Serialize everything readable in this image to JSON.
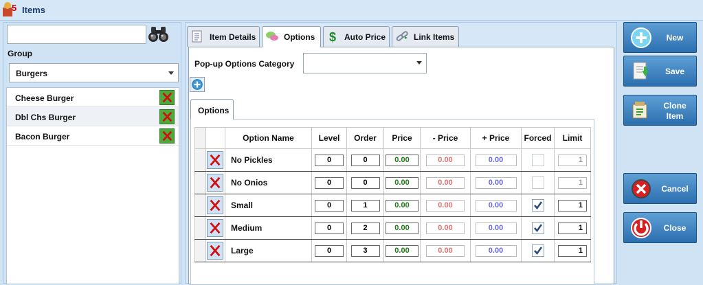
{
  "window": {
    "title": "Items"
  },
  "search": {
    "value": ""
  },
  "group": {
    "label": "Group",
    "selected": "Burgers"
  },
  "items": [
    {
      "name": "Cheese Burger"
    },
    {
      "name": "Dbl Chs Burger"
    },
    {
      "name": "Bacon Burger"
    }
  ],
  "tabs": [
    {
      "label": "Item Details",
      "icon": "document-icon"
    },
    {
      "label": "Options",
      "icon": "speech-bubble-icon"
    },
    {
      "label": "Auto Price",
      "icon": "dollar-icon"
    },
    {
      "label": "Link Items",
      "icon": "link-icon"
    }
  ],
  "options_tab": {
    "category_label": "Pop-up Options Category",
    "category_value": "",
    "subtab_label": "Options"
  },
  "grid": {
    "columns": [
      "Option Name",
      "Level",
      "Order",
      "Price",
      "- Price",
      "+ Price",
      "Forced",
      "Limit"
    ],
    "rows": [
      {
        "name": "No Pickles",
        "level": "0",
        "order": "0",
        "price": "0.00",
        "minus_price": "0.00",
        "plus_price": "0.00",
        "forced": false,
        "limit": "1"
      },
      {
        "name": "No Onios",
        "level": "0",
        "order": "0",
        "price": "0.00",
        "minus_price": "0.00",
        "plus_price": "0.00",
        "forced": false,
        "limit": "1"
      },
      {
        "name": "Small",
        "level": "0",
        "order": "1",
        "price": "0.00",
        "minus_price": "0.00",
        "plus_price": "0.00",
        "forced": true,
        "limit": "1"
      },
      {
        "name": "Medium",
        "level": "0",
        "order": "2",
        "price": "0.00",
        "minus_price": "0.00",
        "plus_price": "0.00",
        "forced": true,
        "limit": "1"
      },
      {
        "name": "Large",
        "level": "0",
        "order": "3",
        "price": "0.00",
        "minus_price": "0.00",
        "plus_price": "0.00",
        "forced": true,
        "limit": "1"
      }
    ]
  },
  "actions": {
    "new": "New",
    "save": "Save",
    "clone_line1": "Clone",
    "clone_line2": "Item",
    "cancel": "Cancel",
    "close": "Close"
  },
  "colors": {
    "accent": "#2b6fb0",
    "price": "#1c7a14",
    "minus_price": "#e07070",
    "plus_price": "#6868d8",
    "delete_green": "#4caa3a",
    "delete_red": "#d01010"
  }
}
